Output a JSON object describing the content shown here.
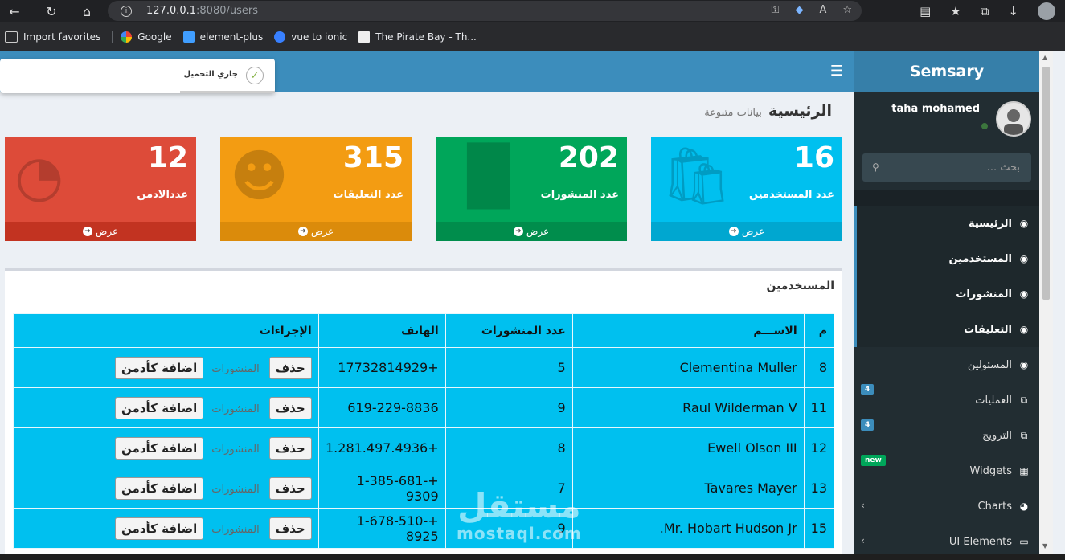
{
  "browser": {
    "url_host": "127.0.0.1",
    "url_path": ":8080/users",
    "bookmarks": [
      "Import favorites",
      "Google",
      "element-plus",
      "vue to ionic",
      "The Pirate Bay - Th..."
    ]
  },
  "app": {
    "logo": "Semsary",
    "toast": "جاري التحميل",
    "page_title": "الرئيسية",
    "page_subtitle": "بيانات متنوعة"
  },
  "stat_boxes": [
    {
      "value": "16",
      "label": "عدد المستخدمين",
      "footer": "عرض",
      "color": "#00c0ef"
    },
    {
      "value": "202",
      "label": "عدد المنشورات",
      "footer": "عرض",
      "color": "#00a65a"
    },
    {
      "value": "315",
      "label": "عدد التعليقات",
      "footer": "عرض",
      "color": "#f39c12"
    },
    {
      "value": "12",
      "label": "عددالادمن",
      "footer": "عرض",
      "color": "#dd4b39"
    }
  ],
  "users_panel": {
    "title": "المستخدمين",
    "columns": [
      "م",
      "الاســـم",
      "عدد المنشورات",
      "الهاتف",
      "الإجراءات"
    ],
    "delete_label": "حذف",
    "posts_label": "المنشورات",
    "make_admin_label": "اضافة كأدمن",
    "rows": [
      {
        "id": "8",
        "name": "Clementina Muller",
        "posts": "5",
        "phone": "+17732814929"
      },
      {
        "id": "11",
        "name": "Raul Wilderman V",
        "posts": "9",
        "phone": "619-229-8836"
      },
      {
        "id": "12",
        "name": "Ewell Olson III",
        "posts": "8",
        "phone": "+1.281.497.4936"
      },
      {
        "id": "13",
        "name": "Tavares Mayer",
        "posts": "7",
        "phone": "+1-385-681-9309"
      },
      {
        "id": "15",
        "name": "Mr. Hobart Hudson Jr.",
        "posts": "9",
        "phone": "+1-678-510-8925"
      }
    ]
  },
  "watermark": {
    "line1": "مستقل",
    "line2": "mostaql.com"
  },
  "sidebar": {
    "user_name": "taha mohamed",
    "search_placeholder": "بحث ...",
    "items": [
      {
        "label": "الرئيسية"
      },
      {
        "label": "المستخدمين"
      },
      {
        "label": "المنشورات"
      },
      {
        "label": "التعليقات"
      },
      {
        "label": "المسئولين"
      },
      {
        "label": "العمليات",
        "badge": "4"
      },
      {
        "label": "الترويج",
        "badge": "4"
      },
      {
        "label": "Widgets",
        "badge": "new"
      },
      {
        "label": "Charts"
      },
      {
        "label": "UI Elements"
      }
    ]
  }
}
